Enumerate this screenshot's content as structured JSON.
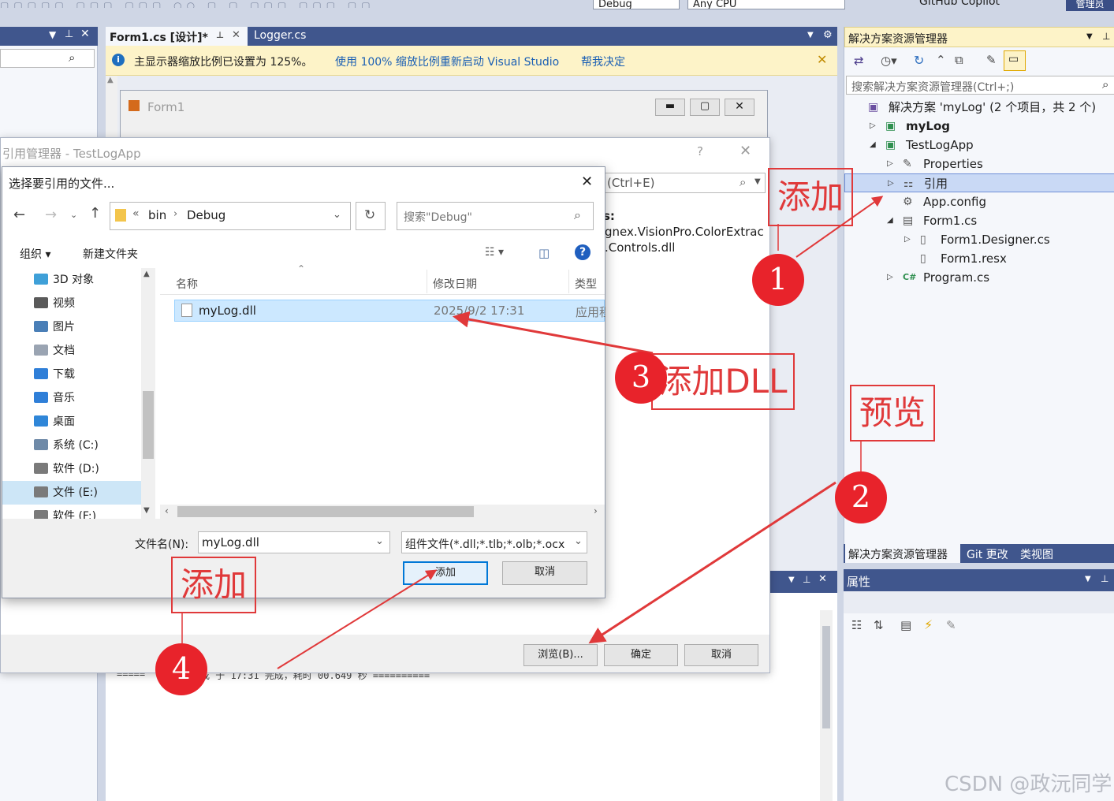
{
  "toolbar": {
    "config": "Debug",
    "platform": "Any CPU",
    "copilot": "GitHub Copilot",
    "admin": "管理员"
  },
  "editor": {
    "tabs": [
      {
        "label": "Form1.cs [设计]*",
        "active": true
      },
      {
        "label": "Logger.cs",
        "active": false
      }
    ],
    "infobar": {
      "message": "主显示器缩放比例已设置为 125%。",
      "link1": "使用 100% 缩放比例重新启动 Visual Studio",
      "link2": "帮我决定"
    },
    "form_title": "Form1",
    "output_line": "======= 于 17:31 完成，耗时 00.649 秒 ==========",
    "output_prefix": "=====",
    "output_suffix": "成 于 17:31 完成，耗时 00.649 秒 =========="
  },
  "ref_manager": {
    "title": "引用管理器 - TestLogApp",
    "search_suffix": "(Ctrl+E)",
    "bold_prefix": "s:",
    "list": [
      "gnex.VisionPro.ColorExtrac",
      ".Controls.dll"
    ],
    "browse": "浏览(B)...",
    "ok": "确定",
    "cancel": "取消"
  },
  "file_dialog": {
    "title": "选择要引用的文件...",
    "breadcrumb": [
      "bin",
      "Debug"
    ],
    "search_placeholder": "搜索\"Debug\"",
    "organize": "组织",
    "new_folder": "新建文件夹",
    "nav": [
      {
        "label": "3D 对象",
        "color": "#3fa0d8"
      },
      {
        "label": "视频",
        "color": "#5a5a5a"
      },
      {
        "label": "图片",
        "color": "#4a7fb7"
      },
      {
        "label": "文档",
        "color": "#9aa4b2"
      },
      {
        "label": "下载",
        "color": "#2f7fd8"
      },
      {
        "label": "音乐",
        "color": "#2f7fd8"
      },
      {
        "label": "桌面",
        "color": "#2f86d8"
      },
      {
        "label": "系统 (C:)",
        "color": "#6f8aa8"
      },
      {
        "label": "软件 (D:)",
        "color": "#7a7a7a"
      },
      {
        "label": "文件 (E:)",
        "color": "#7a7a7a",
        "selected": true
      },
      {
        "label": "软件 (F:)",
        "color": "#7a7a7a"
      }
    ],
    "columns": [
      "名称",
      "修改日期",
      "类型"
    ],
    "files": [
      {
        "name": "myLog.dll",
        "date": "2025/9/2 17:31",
        "type": "应用程"
      }
    ],
    "filename_label": "文件名(N):",
    "filename_value": "myLog.dll",
    "filter": "组件文件(*.dll;*.tlb;*.olb;*.ocx",
    "add": "添加",
    "cancel": "取消"
  },
  "solution_explorer": {
    "title": "解决方案资源管理器",
    "search_placeholder": "搜索解决方案资源管理器(Ctrl+;)",
    "tree": [
      {
        "label": "解决方案 'myLog' (2 个项目，共 2 个)",
        "depth": 0,
        "icon": "solution-icon"
      },
      {
        "label": "myLog",
        "depth": 1,
        "icon": "csproj-icon",
        "bold": true
      },
      {
        "label": "TestLogApp",
        "depth": 1,
        "icon": "csproj-icon"
      },
      {
        "label": "Properties",
        "depth": 2,
        "icon": "wrench-icon"
      },
      {
        "label": "引用",
        "depth": 2,
        "icon": "references-icon",
        "selected": true
      },
      {
        "label": "App.config",
        "depth": 2,
        "icon": "config-icon"
      },
      {
        "label": "Form1.cs",
        "depth": 2,
        "icon": "form-icon"
      },
      {
        "label": "Form1.Designer.cs",
        "depth": 3,
        "icon": "file-icon"
      },
      {
        "label": "Form1.resx",
        "depth": 3,
        "icon": "file-icon"
      },
      {
        "label": "Program.cs",
        "depth": 2,
        "icon": "csharp-icon"
      }
    ],
    "bottom_tabs": [
      "解决方案资源管理器",
      "Git 更改",
      "类视图"
    ]
  },
  "properties": {
    "title": "属性"
  },
  "annotations": {
    "box_add_top": "添加",
    "box_preview": "预览",
    "box_add_dll": "添加DLL",
    "box_add_bottom": "添加",
    "n1": "1",
    "n2": "2",
    "n3": "3",
    "n4": "4"
  },
  "watermark": "CSDN @政沅同学",
  "colors": {
    "accent": "#0078d7",
    "annotation_red": "#e0393a",
    "vs_dark": "#40568d",
    "selection": "#cce8ff"
  }
}
